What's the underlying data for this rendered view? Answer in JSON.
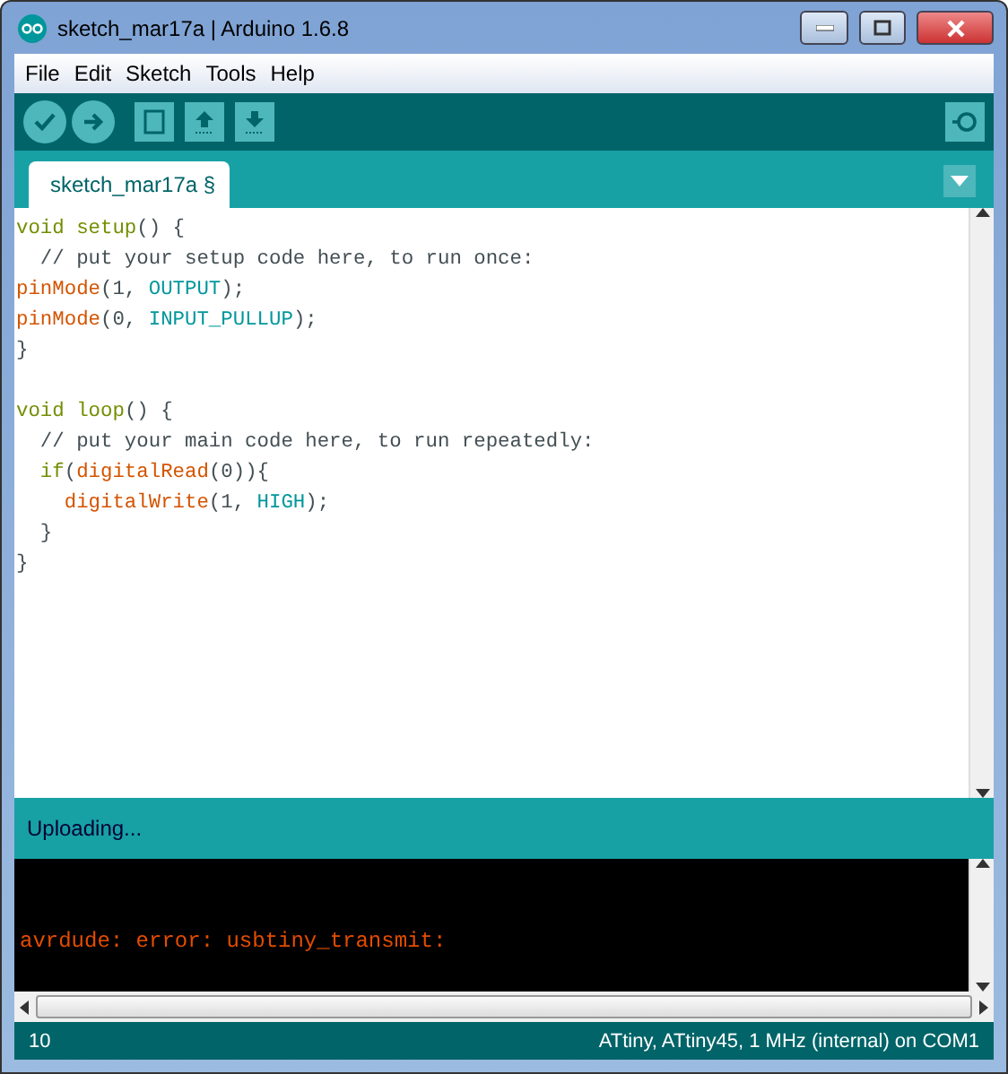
{
  "window": {
    "title": "sketch_mar17a | Arduino 1.6.8"
  },
  "menu": [
    "File",
    "Edit",
    "Sketch",
    "Tools",
    "Help"
  ],
  "tabs": [
    {
      "label": "sketch_mar17a §",
      "selected": true
    }
  ],
  "code": [
    [
      {
        "kind": "keyword",
        "text": "void setup"
      },
      {
        "kind": "plain",
        "text": "() {"
      }
    ],
    [
      {
        "kind": "comment",
        "text": "  // put your setup code here, to run once:"
      }
    ],
    [
      {
        "kind": "function",
        "text": "pinMode"
      },
      {
        "kind": "plain",
        "text": "(1, "
      },
      {
        "kind": "constant",
        "text": "OUTPUT"
      },
      {
        "kind": "plain",
        "text": ");"
      }
    ],
    [
      {
        "kind": "function",
        "text": "pinMode"
      },
      {
        "kind": "plain",
        "text": "(0, "
      },
      {
        "kind": "constant",
        "text": "INPUT_PULLUP"
      },
      {
        "kind": "plain",
        "text": ");"
      }
    ],
    [
      {
        "kind": "plain",
        "text": "}"
      }
    ],
    [
      {
        "kind": "blank"
      }
    ],
    [
      {
        "kind": "keyword",
        "text": "void loop"
      },
      {
        "kind": "plain",
        "text": "() {"
      }
    ],
    [
      {
        "kind": "comment",
        "text": "  // put your main code here, to run repeatedly:"
      }
    ],
    [
      {
        "kind": "keyword",
        "text": "  if"
      },
      {
        "kind": "plain",
        "text": "("
      },
      {
        "kind": "function",
        "text": "digitalRead"
      },
      {
        "kind": "plain",
        "text": "(0)){"
      }
    ],
    [
      {
        "kind": "function",
        "text": "    digitalWrite"
      },
      {
        "kind": "plain",
        "text": "(1, "
      },
      {
        "kind": "constant",
        "text": "HIGH"
      },
      {
        "kind": "plain",
        "text": ");"
      }
    ],
    [
      {
        "kind": "plain",
        "text": "  }"
      }
    ],
    [
      {
        "kind": "plain",
        "text": "}"
      }
    ]
  ],
  "status": "Uploading...",
  "console": [
    "avrdude: error: usbtiny_transmit:"
  ],
  "footer": {
    "line": "10",
    "board": "ATtiny, ATtiny45, 1 MHz (internal) on COM1"
  }
}
